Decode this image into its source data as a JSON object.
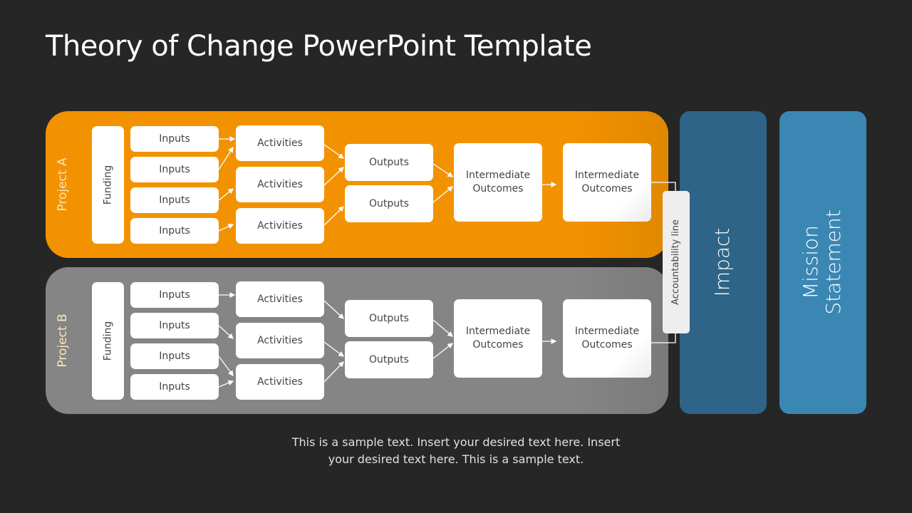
{
  "title": "Theory of Change PowerPoint Template",
  "colors": {
    "background": "#262626",
    "project_a": "#f39200",
    "project_b": "#858585",
    "impact": "#2e6487",
    "mission": "#3b87b4"
  },
  "projects": [
    {
      "label": "Project A",
      "funding": "Funding",
      "inputs": [
        "Inputs",
        "Inputs",
        "Inputs",
        "Inputs"
      ],
      "activities": [
        "Activities",
        "Activities",
        "Activities"
      ],
      "outputs": [
        "Outputs",
        "Outputs"
      ],
      "intermediate": [
        "Intermediate Outcomes",
        "Intermediate Outcomes"
      ]
    },
    {
      "label": "Project B",
      "funding": "Funding",
      "inputs": [
        "Inputs",
        "Inputs",
        "Inputs",
        "Inputs"
      ],
      "activities": [
        "Activities",
        "Activities",
        "Activities"
      ],
      "outputs": [
        "Outputs",
        "Outputs"
      ],
      "intermediate": [
        "Intermediate Outcomes",
        "Intermediate Outcomes"
      ]
    }
  ],
  "accountability": "Accountability line",
  "impact": "Impact",
  "mission": "Mission Statement",
  "caption": "This is a sample text. Insert your desired text here. Insert your desired text here. This is a sample text."
}
